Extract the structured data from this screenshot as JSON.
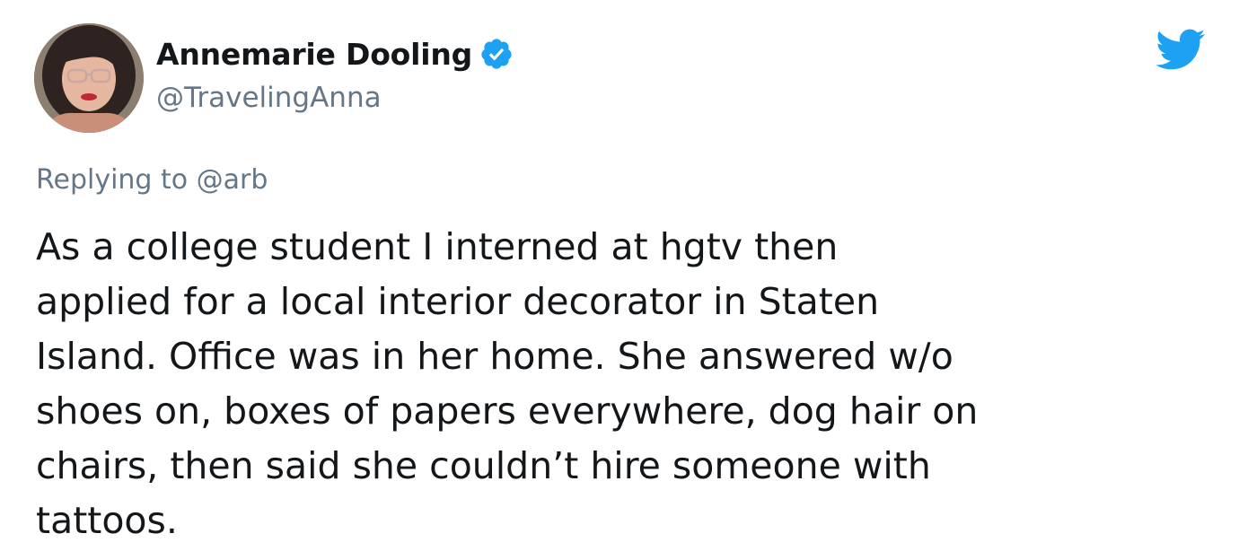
{
  "author": {
    "display_name": "Annemarie Dooling",
    "handle": "@TravelingAnna",
    "verified": true
  },
  "reply": {
    "prefix": "Replying to ",
    "mention": "@arb"
  },
  "tweet": {
    "lines": [
      "As a college student I interned at hgtv then",
      "applied for a local interior decorator in Staten",
      "Island. Office was in her home. She answered w/o",
      "shoes on, boxes of papers everywhere, dog hair on",
      "chairs, then said she couldn’t hire someone with",
      "tattoos."
    ]
  },
  "icons": {
    "verified": "verified-badge-icon",
    "logo": "twitter-bird-icon"
  },
  "colors": {
    "brand": "#1da1f2",
    "text": "#14171a",
    "secondary": "#657786"
  }
}
